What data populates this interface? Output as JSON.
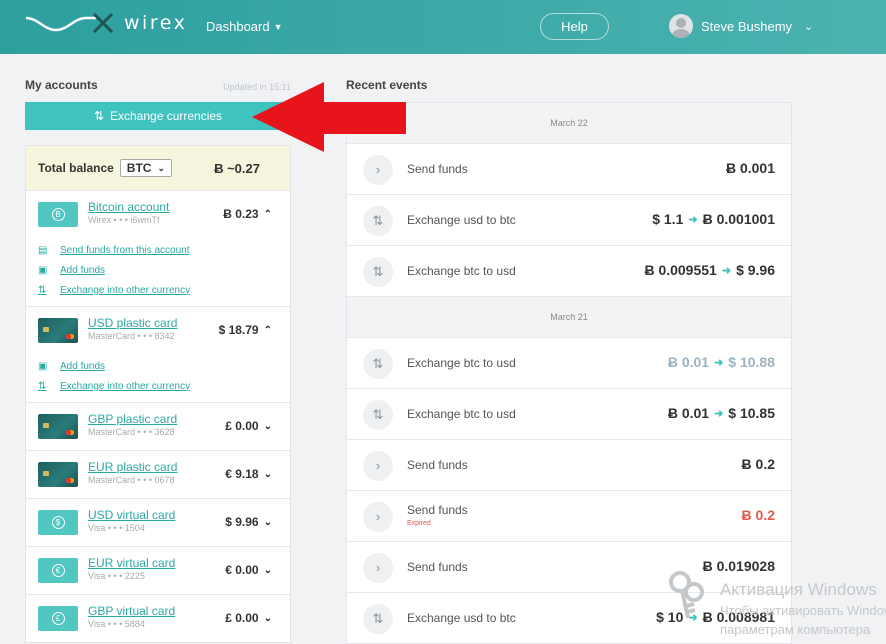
{
  "header": {
    "brand": "wirex",
    "nav_dashboard": "Dashboard",
    "help": "Help",
    "user_name": "Steve Bushemy"
  },
  "accounts": {
    "title": "My accounts",
    "updated": "Updated in 15:11",
    "exchange_button": "Exchange currencies",
    "total_label": "Total balance",
    "total_currency": "BTC",
    "total_value": "Ƀ ~0.27",
    "items": [
      {
        "name": "Bitcoin account",
        "sub": "Wirex • • • i6wmTf",
        "balance": "Ƀ 0.23",
        "expanded": true,
        "actions": [
          "Send funds from this account",
          "Add funds",
          "Exchange into other currency"
        ]
      },
      {
        "name": "USD plastic card",
        "sub": "MasterCard • • • 8342",
        "balance": "$ 18.79",
        "expanded": true,
        "actions": [
          "Add funds",
          "Exchange into other currency"
        ]
      },
      {
        "name": "GBP plastic card",
        "sub": "MasterCard • • • 3628",
        "balance": "£ 0.00"
      },
      {
        "name": "EUR plastic card",
        "sub": "MasterCard • • • 0678",
        "balance": "€ 9.18"
      },
      {
        "name": "USD virtual card",
        "sub": "Visa • • • 1504",
        "balance": "$ 9.96"
      },
      {
        "name": "EUR virtual card",
        "sub": "Visa • • • 2225",
        "balance": "€ 0.00"
      },
      {
        "name": "GBP virtual card",
        "sub": "Visa • • • 5884",
        "balance": "£ 0.00"
      }
    ]
  },
  "events": {
    "title": "Recent events",
    "groups": [
      {
        "date": "March 22",
        "items": [
          {
            "label": "Send funds",
            "from": "Ƀ 0.001"
          },
          {
            "label": "Exchange usd to btc",
            "from": "$ 1.1",
            "to": "Ƀ 0.001001"
          },
          {
            "label": "Exchange btc to usd",
            "from": "Ƀ 0.009551",
            "to": "$ 9.96"
          }
        ]
      },
      {
        "date": "March 21",
        "items": [
          {
            "label": "Exchange btc to usd",
            "from": "Ƀ 0.01",
            "to": "$ 10.88"
          },
          {
            "label": "Exchange btc to usd",
            "from": "Ƀ 0.01",
            "to": "$ 10.85"
          },
          {
            "label": "Send funds",
            "from": "Ƀ 0.2"
          },
          {
            "label": "Send funds",
            "status": "Expired",
            "from": "Ƀ 0.2"
          },
          {
            "label": "Send funds",
            "from": "Ƀ 0.019028"
          },
          {
            "label": "Exchange usd to btc",
            "from": "$ 10",
            "to": "Ƀ 0.008981"
          }
        ]
      }
    ]
  },
  "watermark": {
    "title": "Активация Windows",
    "line1": "Чтобы активировать Windows",
    "line2": "параметрам компьютера"
  },
  "colors": {
    "accent": "#3fc3be",
    "header": "#3aa9a7",
    "arrow": "#e8141c",
    "expired": "#e05a4e"
  }
}
